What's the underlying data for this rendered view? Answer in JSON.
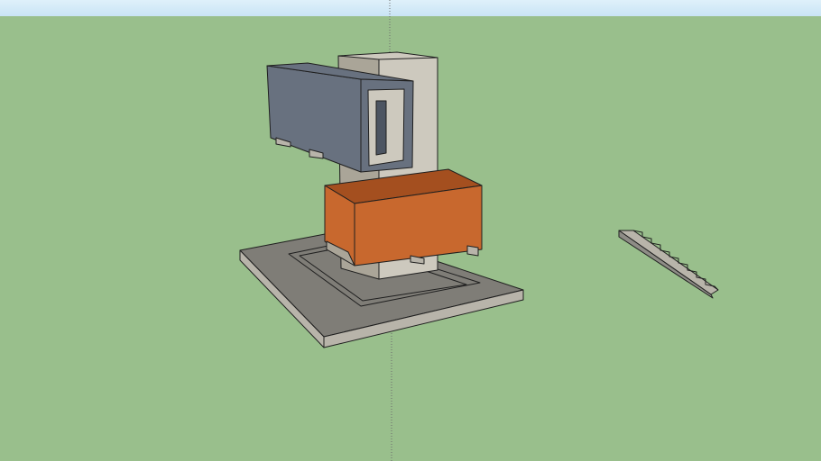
{
  "viewport": {
    "sky_color": "#c9e4f5",
    "sky_highlight": "#dff0fa",
    "ground_color": "#99bf8c",
    "axis_color": "#6b6b6b"
  },
  "model": {
    "slab_top_color": "#7f7d77",
    "slab_edge_color": "#b8b4aa",
    "tower_light_color": "#cdc9be",
    "tower_shade_color": "#aaa598",
    "blue_volume_color": "#68717f",
    "blue_volume_dark": "#4d5562",
    "orange_volume_color": "#c8682e",
    "orange_volume_top": "#a44f1f",
    "stair_color": "#8e8c86",
    "outline_color": "#1f1f1f"
  }
}
